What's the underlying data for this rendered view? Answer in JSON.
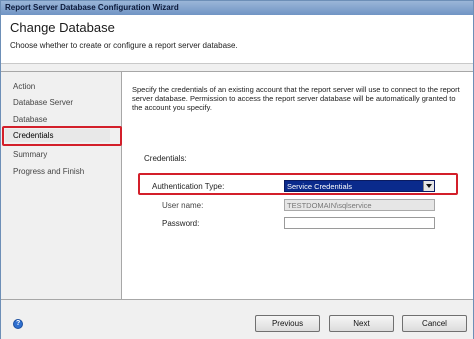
{
  "window": {
    "title": "Report Server Database Configuration Wizard"
  },
  "header": {
    "title": "Change Database",
    "subtitle": "Choose whether to create or configure a report server database."
  },
  "sidebar": {
    "items": [
      {
        "label": "Action",
        "selected": false
      },
      {
        "label": "Database Server",
        "selected": false
      },
      {
        "label": "Database",
        "selected": false
      },
      {
        "label": "Credentials",
        "selected": true
      },
      {
        "label": "Summary",
        "selected": false
      },
      {
        "label": "Progress and Finish",
        "selected": false
      }
    ]
  },
  "content": {
    "description": "Specify the credentials of an existing account that the report server will use to connect to the report server database.  Permission to access the report server database will be automatically granted to the account you specify.",
    "credentials_label": "Credentials:",
    "auth_type_label": "Authentication Type:",
    "auth_type_value": "Service Credentials",
    "username_label": "User name:",
    "username_value": "TESTDOMAIN\\sqlservice",
    "password_label": "Password:",
    "password_value": ""
  },
  "footer": {
    "help_icon": "?",
    "previous_label": "Previous",
    "next_label": "Next",
    "cancel_label": "Cancel"
  },
  "colors": {
    "highlight_frame": "#d31f2a",
    "selected_value_bg": "#0a2a8c",
    "titlebar": "#7094c4"
  }
}
